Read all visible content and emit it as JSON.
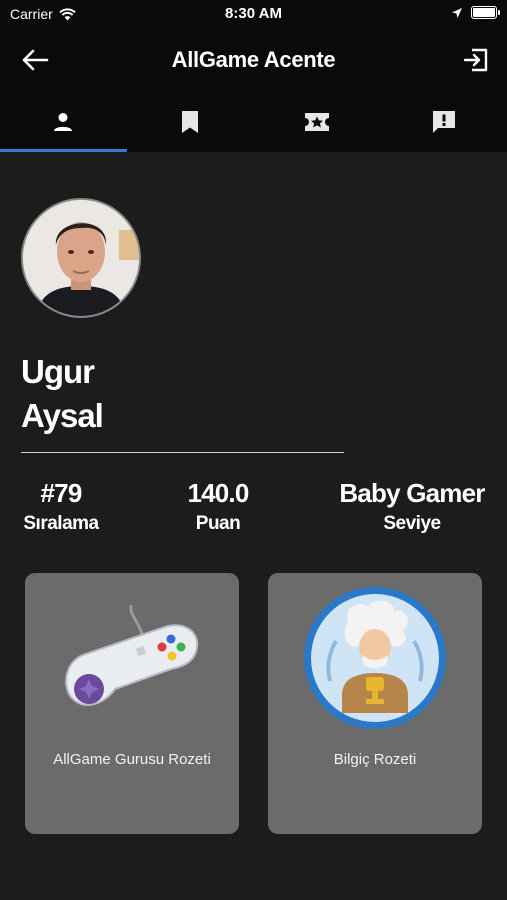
{
  "status_bar": {
    "carrier": "Carrier",
    "time": "8:30 AM",
    "battery_level": 1.0
  },
  "header": {
    "title": "AllGame Acente"
  },
  "tabs": [
    {
      "icon": "person-icon",
      "active": true
    },
    {
      "icon": "bookmark-icon",
      "active": false
    },
    {
      "icon": "ticket-star-icon",
      "active": false
    },
    {
      "icon": "feedback-icon",
      "active": false
    }
  ],
  "profile": {
    "first_name": "Ugur",
    "last_name": "Aysal",
    "stats": [
      {
        "value": "#79",
        "label": "Sıralama"
      },
      {
        "value": "140.0",
        "label": "Puan"
      },
      {
        "value": "Baby Gamer",
        "label": "Seviye"
      }
    ]
  },
  "badges": [
    {
      "label": "AllGame Gurusu Rozeti",
      "icon": "gamepad-icon"
    },
    {
      "label": "Bilgiç Rozeti",
      "icon": "einstein-badge-icon"
    }
  ],
  "colors": {
    "background": "#1c1c1c",
    "bar": "#0a0a0a",
    "accent": "#2f7fd0",
    "card": "#6b6b6b"
  }
}
